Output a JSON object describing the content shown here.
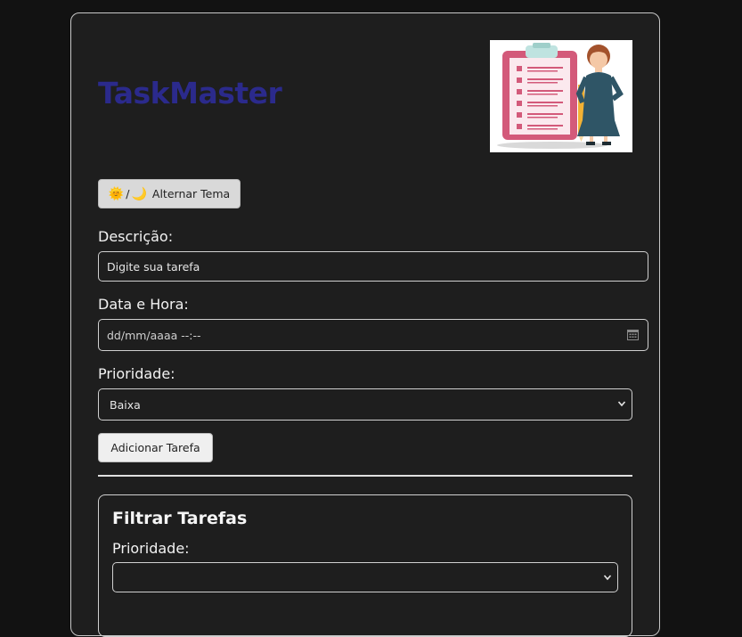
{
  "app": {
    "title": "TaskMaster"
  },
  "theme_toggle": {
    "label": "Alternar Tema",
    "sun_glyph": "🌞",
    "separator": "/",
    "moon_glyph": "🌙"
  },
  "form": {
    "description": {
      "label": "Descrição:",
      "value": "Digite sua tarefa"
    },
    "datetime": {
      "label": "Data e Hora:",
      "value": "dd/mm/aaaa --:--"
    },
    "priority": {
      "label": "Prioridade:",
      "selected": "Baixa"
    },
    "submit_label": "Adicionar Tarefa"
  },
  "filter": {
    "title": "Filtrar Tarefas",
    "priority_label": "Prioridade:",
    "priority_selected": ""
  },
  "colors": {
    "page_bg": "#121212",
    "card_bg": "#1e1e1e",
    "title": "#2b2a8c"
  },
  "icons": [
    "sun-icon",
    "moon-icon",
    "calendar-icon",
    "chevron-down-icon",
    "checklist-illustration"
  ]
}
